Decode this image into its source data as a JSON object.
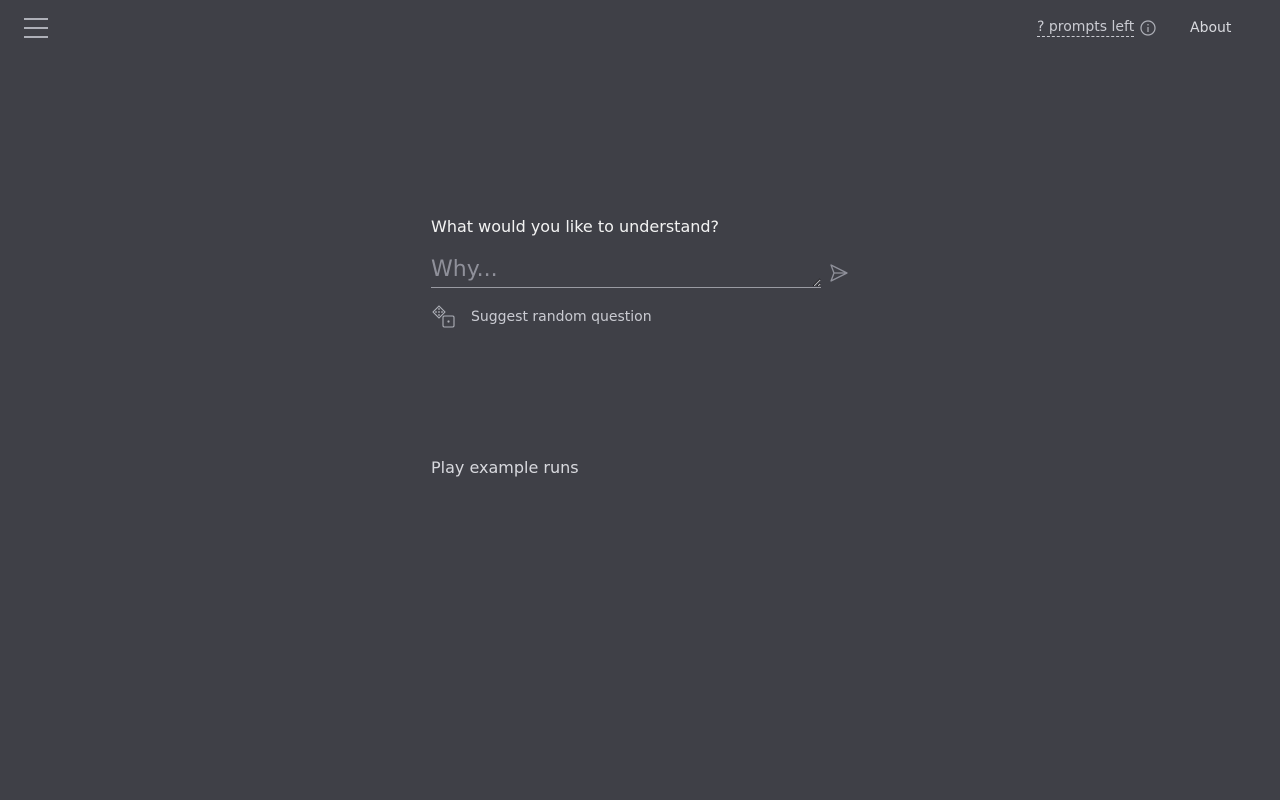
{
  "header": {
    "menu_icon": "hamburger-menu-icon",
    "prompts_left": "? prompts left",
    "info_icon": "info-circle-icon",
    "about_label": "About"
  },
  "main": {
    "heading": "What would you like to understand?",
    "question_input": {
      "value": "",
      "placeholder": "Why..."
    },
    "send_icon": "send-arrow-icon",
    "suggest": {
      "icon": "dice-icon",
      "label": "Suggest random question"
    },
    "play_examples_label": "Play example runs"
  },
  "colors": {
    "background": "#3f4047",
    "text_primary": "#f2f2f2",
    "text_secondary": "#c9cad1",
    "placeholder": "#8f909a"
  }
}
